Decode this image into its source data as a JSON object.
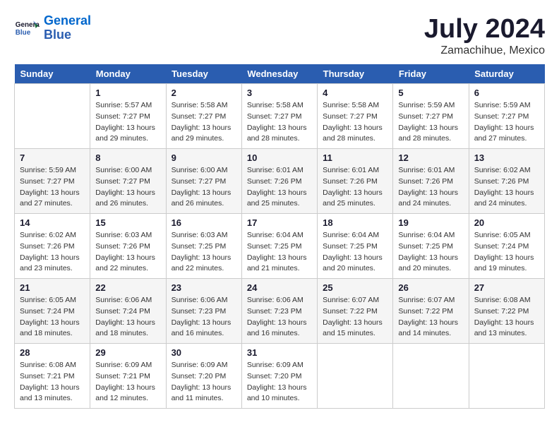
{
  "header": {
    "logo_line1": "General",
    "logo_line2": "Blue",
    "main_title": "July 2024",
    "subtitle": "Zamachihue, Mexico"
  },
  "days_of_week": [
    "Sunday",
    "Monday",
    "Tuesday",
    "Wednesday",
    "Thursday",
    "Friday",
    "Saturday"
  ],
  "weeks": [
    [
      {
        "num": "",
        "detail": ""
      },
      {
        "num": "1",
        "detail": "Sunrise: 5:57 AM\nSunset: 7:27 PM\nDaylight: 13 hours\nand 29 minutes."
      },
      {
        "num": "2",
        "detail": "Sunrise: 5:58 AM\nSunset: 7:27 PM\nDaylight: 13 hours\nand 29 minutes."
      },
      {
        "num": "3",
        "detail": "Sunrise: 5:58 AM\nSunset: 7:27 PM\nDaylight: 13 hours\nand 28 minutes."
      },
      {
        "num": "4",
        "detail": "Sunrise: 5:58 AM\nSunset: 7:27 PM\nDaylight: 13 hours\nand 28 minutes."
      },
      {
        "num": "5",
        "detail": "Sunrise: 5:59 AM\nSunset: 7:27 PM\nDaylight: 13 hours\nand 28 minutes."
      },
      {
        "num": "6",
        "detail": "Sunrise: 5:59 AM\nSunset: 7:27 PM\nDaylight: 13 hours\nand 27 minutes."
      }
    ],
    [
      {
        "num": "7",
        "detail": "Sunrise: 5:59 AM\nSunset: 7:27 PM\nDaylight: 13 hours\nand 27 minutes."
      },
      {
        "num": "8",
        "detail": "Sunrise: 6:00 AM\nSunset: 7:27 PM\nDaylight: 13 hours\nand 26 minutes."
      },
      {
        "num": "9",
        "detail": "Sunrise: 6:00 AM\nSunset: 7:27 PM\nDaylight: 13 hours\nand 26 minutes."
      },
      {
        "num": "10",
        "detail": "Sunrise: 6:01 AM\nSunset: 7:26 PM\nDaylight: 13 hours\nand 25 minutes."
      },
      {
        "num": "11",
        "detail": "Sunrise: 6:01 AM\nSunset: 7:26 PM\nDaylight: 13 hours\nand 25 minutes."
      },
      {
        "num": "12",
        "detail": "Sunrise: 6:01 AM\nSunset: 7:26 PM\nDaylight: 13 hours\nand 24 minutes."
      },
      {
        "num": "13",
        "detail": "Sunrise: 6:02 AM\nSunset: 7:26 PM\nDaylight: 13 hours\nand 24 minutes."
      }
    ],
    [
      {
        "num": "14",
        "detail": "Sunrise: 6:02 AM\nSunset: 7:26 PM\nDaylight: 13 hours\nand 23 minutes."
      },
      {
        "num": "15",
        "detail": "Sunrise: 6:03 AM\nSunset: 7:26 PM\nDaylight: 13 hours\nand 22 minutes."
      },
      {
        "num": "16",
        "detail": "Sunrise: 6:03 AM\nSunset: 7:25 PM\nDaylight: 13 hours\nand 22 minutes."
      },
      {
        "num": "17",
        "detail": "Sunrise: 6:04 AM\nSunset: 7:25 PM\nDaylight: 13 hours\nand 21 minutes."
      },
      {
        "num": "18",
        "detail": "Sunrise: 6:04 AM\nSunset: 7:25 PM\nDaylight: 13 hours\nand 20 minutes."
      },
      {
        "num": "19",
        "detail": "Sunrise: 6:04 AM\nSunset: 7:25 PM\nDaylight: 13 hours\nand 20 minutes."
      },
      {
        "num": "20",
        "detail": "Sunrise: 6:05 AM\nSunset: 7:24 PM\nDaylight: 13 hours\nand 19 minutes."
      }
    ],
    [
      {
        "num": "21",
        "detail": "Sunrise: 6:05 AM\nSunset: 7:24 PM\nDaylight: 13 hours\nand 18 minutes."
      },
      {
        "num": "22",
        "detail": "Sunrise: 6:06 AM\nSunset: 7:24 PM\nDaylight: 13 hours\nand 18 minutes."
      },
      {
        "num": "23",
        "detail": "Sunrise: 6:06 AM\nSunset: 7:23 PM\nDaylight: 13 hours\nand 16 minutes."
      },
      {
        "num": "24",
        "detail": "Sunrise: 6:06 AM\nSunset: 7:23 PM\nDaylight: 13 hours\nand 16 minutes."
      },
      {
        "num": "25",
        "detail": "Sunrise: 6:07 AM\nSunset: 7:22 PM\nDaylight: 13 hours\nand 15 minutes."
      },
      {
        "num": "26",
        "detail": "Sunrise: 6:07 AM\nSunset: 7:22 PM\nDaylight: 13 hours\nand 14 minutes."
      },
      {
        "num": "27",
        "detail": "Sunrise: 6:08 AM\nSunset: 7:22 PM\nDaylight: 13 hours\nand 13 minutes."
      }
    ],
    [
      {
        "num": "28",
        "detail": "Sunrise: 6:08 AM\nSunset: 7:21 PM\nDaylight: 13 hours\nand 13 minutes."
      },
      {
        "num": "29",
        "detail": "Sunrise: 6:09 AM\nSunset: 7:21 PM\nDaylight: 13 hours\nand 12 minutes."
      },
      {
        "num": "30",
        "detail": "Sunrise: 6:09 AM\nSunset: 7:20 PM\nDaylight: 13 hours\nand 11 minutes."
      },
      {
        "num": "31",
        "detail": "Sunrise: 6:09 AM\nSunset: 7:20 PM\nDaylight: 13 hours\nand 10 minutes."
      },
      {
        "num": "",
        "detail": ""
      },
      {
        "num": "",
        "detail": ""
      },
      {
        "num": "",
        "detail": ""
      }
    ]
  ]
}
